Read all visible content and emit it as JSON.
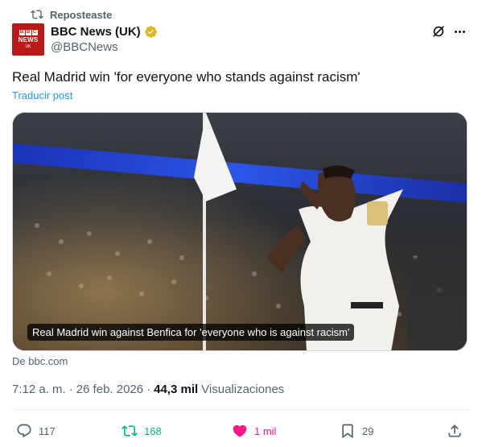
{
  "repost_label": "Reposteaste",
  "author": {
    "avatar_text": "BBC NEWS UK",
    "display_name": "BBC News (UK)",
    "handle": "@BBCNews",
    "verified": true,
    "verified_color": "#e2b719"
  },
  "tweet": {
    "text": "Real Madrid win 'for everyone who stands against racism'",
    "translate_label": "Traducir post"
  },
  "media": {
    "caption": "Real Madrid win against Benfica for 'everyone who is against racism'",
    "source": "De bbc.com"
  },
  "meta": {
    "time": "7:12 a. m.",
    "separator": "·",
    "date": "26 feb. 2026",
    "views_count": "44,3 mil",
    "views_label": "Visualizaciones"
  },
  "actions": {
    "replies": "117",
    "reposts": "168",
    "likes": "1 mil",
    "bookmarks": "29"
  },
  "colors": {
    "accent_blue": "#1d9bf0",
    "repost_green": "#00ba7c",
    "like_pink": "#f91880",
    "secondary_text": "#536471",
    "bbc_red": "#bb1919"
  },
  "icons": [
    "repost-icon",
    "verified-badge-icon",
    "grok-icon",
    "more-icon",
    "reply-icon",
    "like-icon",
    "bookmark-icon",
    "share-icon"
  ]
}
